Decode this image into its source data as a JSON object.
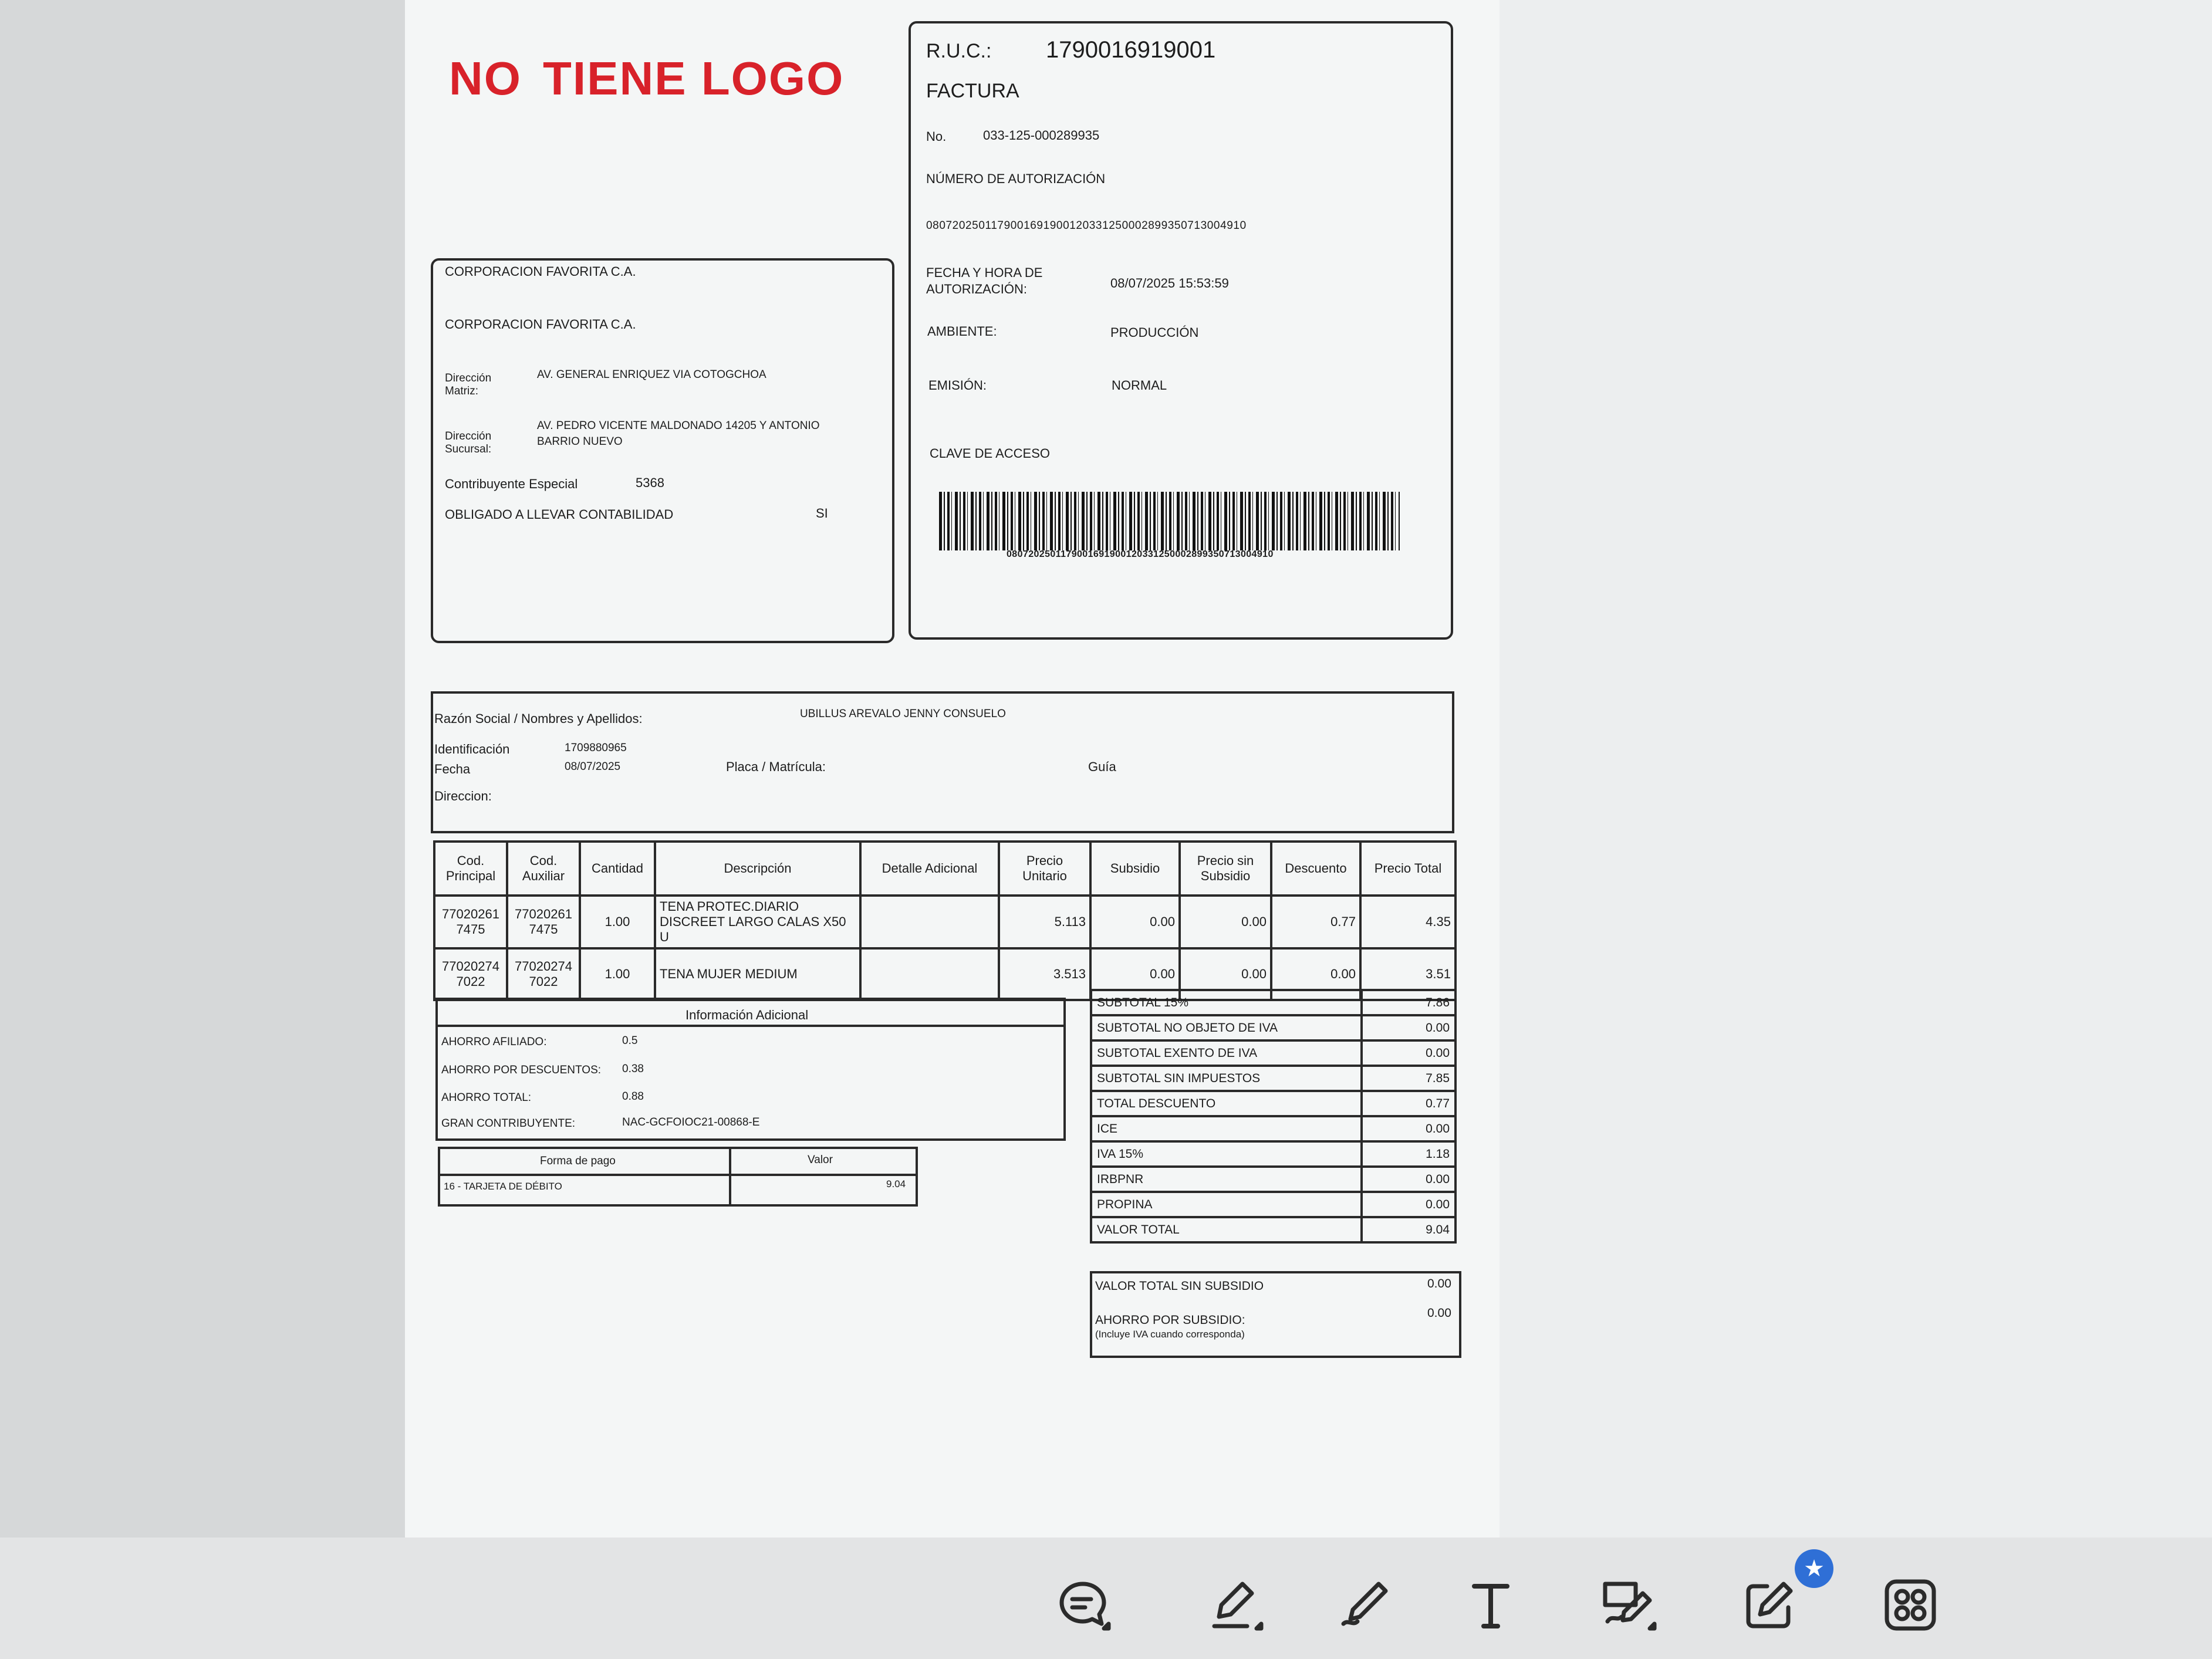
{
  "logo": {
    "word1": "NO",
    "word2": "TIENE LOGO"
  },
  "issuer": {
    "name1": "CORPORACION FAVORITA C.A.",
    "name2": "CORPORACION FAVORITA C.A.",
    "matriz_label": "Dirección Matriz:",
    "matriz_value": "AV. GENERAL ENRIQUEZ VIA COTOGCHOA",
    "sucursal_label": "Dirección Sucursal:",
    "sucursal_value_line1": "AV. PEDRO VICENTE MALDONADO 14205 Y ANTONIO",
    "sucursal_value_line2": "BARRIO NUEVO",
    "contrib_label": "Contribuyente Especial",
    "contrib_value": "5368",
    "obligado_label": "OBLIGADO A LLEVAR CONTABILIDAD",
    "obligado_value": "SI"
  },
  "invoice": {
    "ruc_label": "R.U.C.:",
    "ruc_value": "1790016919001",
    "doc_type": "FACTURA",
    "no_label": "No.",
    "no_value": "033-125-000289935",
    "auth_label": "NÚMERO DE AUTORIZACIÓN",
    "auth_value": "0807202501179001691900120331250002899350713004910",
    "fecha_label_line1": "FECHA Y HORA DE",
    "fecha_label_line2": "AUTORIZACIÓN:",
    "fecha_value": "08/07/2025 15:53:59",
    "ambiente_label": "AMBIENTE:",
    "ambiente_value": "PRODUCCIÓN",
    "emision_label": "EMISIÓN:",
    "emision_value": "NORMAL",
    "clave_label": "CLAVE DE ACCESO",
    "clave_value": "0807202501179001691900120331250002899350713004910"
  },
  "customer": {
    "razon_label": "Razón Social / Nombres y Apellidos:",
    "razon_value": "UBILLUS AREVALO JENNY CONSUELO",
    "id_label": "Identificación",
    "id_value": "1709880965",
    "fecha_label": "Fecha",
    "fecha_value": "08/07/2025",
    "placa_label": "Placa / Matrícula:",
    "guia_label": "Guía",
    "direccion_label": "Direccion:"
  },
  "items": {
    "headers": [
      "Cod. Principal",
      "Cod. Auxiliar",
      "Cantidad",
      "Descripción",
      "Detalle Adicional",
      "Precio Unitario",
      "Subsidio",
      "Precio sin Subsidio",
      "Descuento",
      "Precio Total"
    ],
    "rows": [
      [
        "770202617475",
        "770202617475",
        "1.00",
        "TENA PROTEC.DIARIO DISCREET LARGO CALAS X50 U",
        "",
        "5.113",
        "0.00",
        "0.00",
        "0.77",
        "4.35"
      ],
      [
        "770202747022",
        "770202747022",
        "1.00",
        "TENA MUJER MEDIUM",
        "",
        "3.513",
        "0.00",
        "0.00",
        "0.00",
        "3.51"
      ]
    ]
  },
  "info_adicional": {
    "title": "Información Adicional",
    "rows": [
      {
        "label": "AHORRO AFILIADO:",
        "value": "0.5"
      },
      {
        "label": "AHORRO POR DESCUENTOS:",
        "value": "0.38"
      },
      {
        "label": "AHORRO TOTAL:",
        "value": "0.88"
      },
      {
        "label": "GRAN CONTRIBUYENTE:",
        "value": "NAC-GCFOIOC21-00868-E"
      }
    ]
  },
  "pago": {
    "h_forma": "Forma de pago",
    "h_valor": "Valor",
    "forma": "16 - TARJETA DE DÉBITO",
    "valor": "9.04"
  },
  "totals": [
    {
      "label": "SUBTOTAL 15%",
      "value": "7.86"
    },
    {
      "label": "SUBTOTAL NO OBJETO DE IVA",
      "value": "0.00"
    },
    {
      "label": "SUBTOTAL EXENTO DE IVA",
      "value": "0.00"
    },
    {
      "label": "SUBTOTAL SIN IMPUESTOS",
      "value": "7.85"
    },
    {
      "label": "TOTAL DESCUENTO",
      "value": "0.77"
    },
    {
      "label": "ICE",
      "value": "0.00"
    },
    {
      "label": "IVA 15%",
      "value": "1.18"
    },
    {
      "label": "IRBPNR",
      "value": "0.00"
    },
    {
      "label": "PROPINA",
      "value": "0.00"
    },
    {
      "label": "VALOR TOTAL",
      "value": "9.04"
    }
  ],
  "subsidio": {
    "total_label": "VALOR TOTAL SIN SUBSIDIO",
    "total_value": "0.00",
    "ahorro_label": "AHORRO POR SUBSIDIO:",
    "ahorro_note": "(Incluye IVA cuando corresponda)",
    "ahorro_value": "0.00"
  },
  "toolbar": {
    "icons": [
      "comment-icon",
      "highlighter-icon",
      "pen-icon",
      "text-icon",
      "signature-icon",
      "edit-note-icon",
      "grid-apps-icon"
    ],
    "accent": "#2f6fd6"
  }
}
